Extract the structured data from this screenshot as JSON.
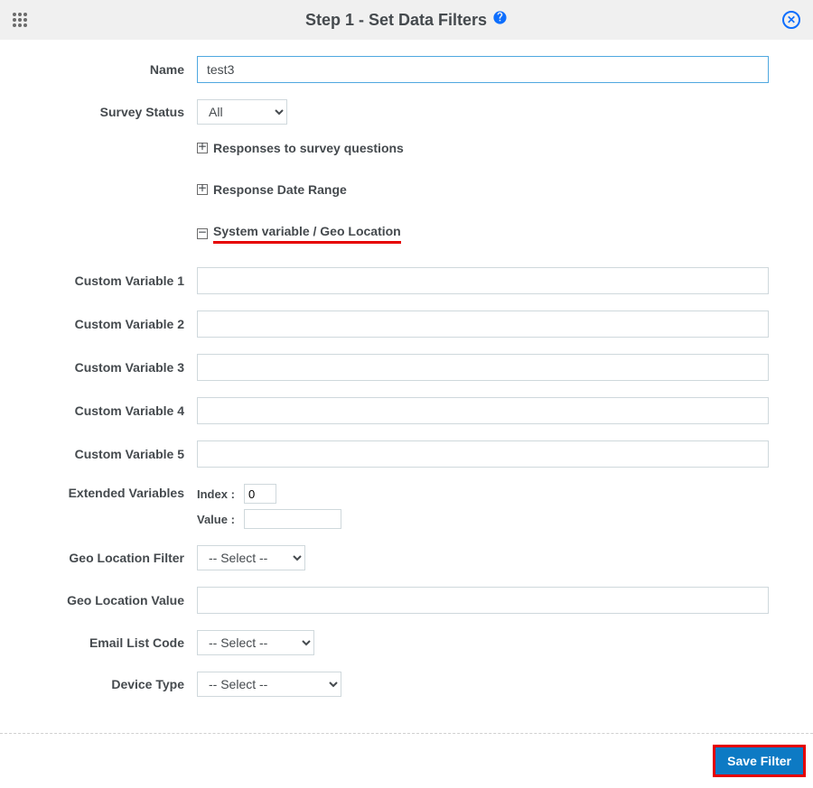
{
  "header": {
    "title": "Step 1 - Set Data Filters"
  },
  "form": {
    "name_label": "Name",
    "name_value": "test3",
    "survey_status_label": "Survey Status",
    "survey_status_value": "All",
    "section_responses": "Responses to survey questions",
    "section_date_range": "Response Date Range",
    "section_sysvar": "System variable / Geo Location",
    "custom_var_1_label": "Custom Variable 1",
    "custom_var_1_value": "",
    "custom_var_2_label": "Custom Variable 2",
    "custom_var_2_value": "",
    "custom_var_3_label": "Custom Variable 3",
    "custom_var_3_value": "",
    "custom_var_4_label": "Custom Variable 4",
    "custom_var_4_value": "",
    "custom_var_5_label": "Custom Variable 5",
    "custom_var_5_value": "",
    "extvar_label": "Extended Variables",
    "extvar_index_label": "Index :",
    "extvar_index_value": "0",
    "extvar_value_label": "Value :",
    "extvar_value_value": "",
    "geo_filter_label": "Geo Location Filter",
    "geo_filter_value": "-- Select --",
    "geo_value_label": "Geo Location Value",
    "geo_value_value": "",
    "email_list_label": "Email List Code",
    "email_list_value": "-- Select --",
    "device_type_label": "Device Type",
    "device_type_value": "-- Select --"
  },
  "footer": {
    "save_label": "Save Filter"
  }
}
